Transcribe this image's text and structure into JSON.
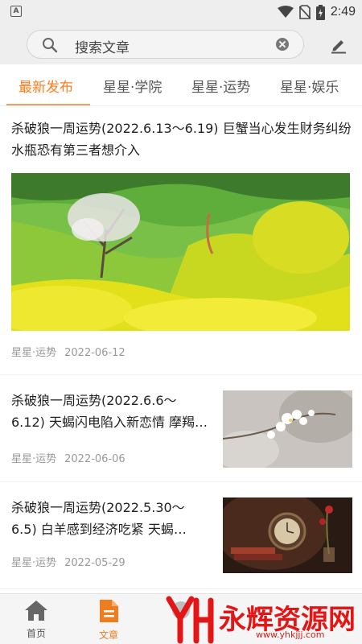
{
  "status_bar": {
    "time": "2:49",
    "app_badge": "A"
  },
  "search": {
    "placeholder": "搜索文章"
  },
  "tabs": [
    {
      "label": "最新发布",
      "active": true
    },
    {
      "label": "星星·学院",
      "active": false
    },
    {
      "label": "星星·运势",
      "active": false
    },
    {
      "label": "星星·娱乐",
      "active": false
    }
  ],
  "articles": [
    {
      "title": "杀破狼一周运势(2022.6.13～6.19) 巨蟹当心发生财务纠纷 水瓶恐有第三者想介入",
      "category": "星星·运势",
      "date": "2022-06-12"
    },
    {
      "title_line1": "杀破狼一周运势(2022.6.6～",
      "title_line2": "6.12) 天蝎闪电陷入新恋情 摩羯…",
      "category": "星星·运势",
      "date": "2022-06-06"
    },
    {
      "title_line1": "杀破狼一周运势(2022.5.30～",
      "title_line2": "6.5) 白羊感到经济吃紧 天蝎…",
      "category": "星星·运势",
      "date": "2022-05-29"
    }
  ],
  "bottom_nav": [
    {
      "label": "首页",
      "icon": "home-icon",
      "active": false
    },
    {
      "label": "文章",
      "icon": "article-icon",
      "active": true
    },
    {
      "label": "",
      "icon": "hidden-icon",
      "active": false
    }
  ],
  "watermark": {
    "text": "永辉资源网",
    "url": "www.yhkjjj.com"
  },
  "colors": {
    "accent": "#ff7d1e",
    "watermark": "#e21616"
  }
}
